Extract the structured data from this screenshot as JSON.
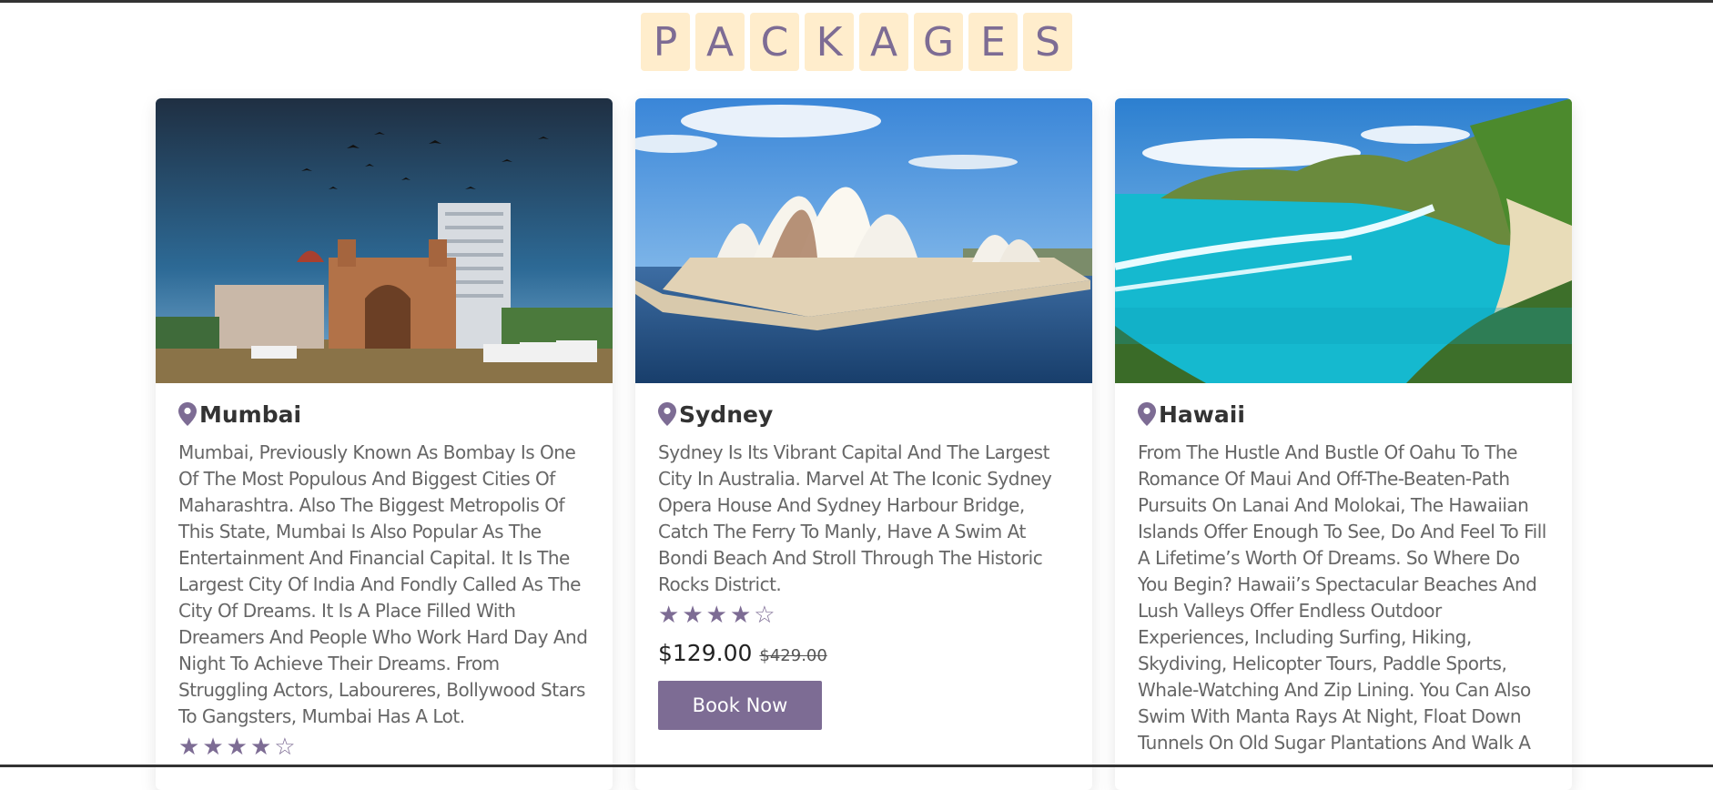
{
  "heading": {
    "letters": [
      "P",
      "A",
      "C",
      "K",
      "A",
      "G",
      "E",
      "S"
    ]
  },
  "packages": [
    {
      "name": "Mumbai",
      "image_icon": "mumbai-gateway-image",
      "description": "Mumbai, Previously Known As Bombay Is One Of The Most Populous And Biggest Cities Of Maharashtra. Also The Biggest Metropolis Of This State, Mumbai Is Also Popular As The Entertainment And Financial Capital. It Is The Largest City Of India And Fondly Called As The City Of Dreams. It Is A Place Filled With Dreamers And People Who Work Hard Day And Night To Achieve Their Dreams. From Struggling Actors, Laboureres, Bollywood Stars To Gangsters, Mumbai Has A Lot.",
      "rating": 4,
      "rating_max": 5
    },
    {
      "name": "Sydney",
      "image_icon": "sydney-opera-house-image",
      "description": "Sydney Is Its Vibrant Capital And The Largest City In Australia. Marvel At The Iconic Sydney Opera House And Sydney Harbour Bridge, Catch The Ferry To Manly, Have A Swim At Bondi Beach And Stroll Through The Historic Rocks District.",
      "rating": 4,
      "rating_max": 5,
      "price": "$129.00",
      "old_price": "$429.00",
      "button_label": "Book Now"
    },
    {
      "name": "Hawaii",
      "image_icon": "hawaii-bay-image",
      "description": "From The Hustle And Bustle Of Oahu To The Romance Of Maui And Off-The-Beaten-Path Pursuits On Lanai And Molokai, The Hawaiian Islands Offer Enough To See, Do And Feel To Fill A Lifetime’s Worth Of Dreams. So Where Do You Begin? Hawaii’s Spectacular Beaches And Lush Valleys Offer Endless Outdoor Experiences, Including Surfing, Hiking, Skydiving, Helicopter Tours, Paddle Sports, Whale-Watching And Zip Lining. You Can Also Swim With Manta Rays At Night, Float Down Tunnels On Old Sugar Plantations And Walk A"
    }
  ],
  "colors": {
    "accent": "#7d6c94",
    "letter_bg": "#ffedcc"
  }
}
